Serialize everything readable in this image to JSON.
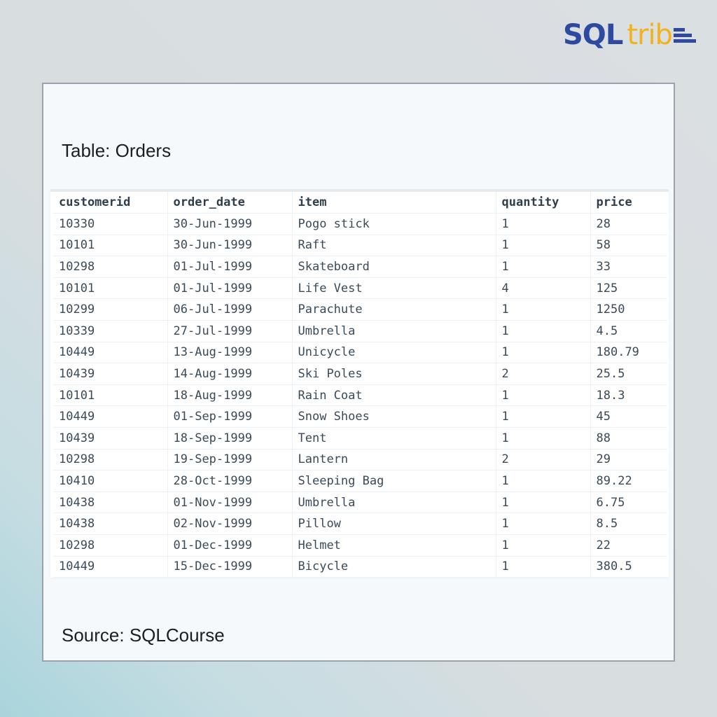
{
  "brand": {
    "part1": "SQL",
    "part2": "trib",
    "colors": {
      "sql": "#2d4aa0",
      "trib": "#f2b21b",
      "bars": "#2d4aa0"
    }
  },
  "card": {
    "title": "Table: Orders",
    "source": "Source: SQLCourse"
  },
  "table": {
    "columns": [
      "customerid",
      "order_date",
      "item",
      "quantity",
      "price"
    ],
    "rows": [
      [
        "10330",
        "30-Jun-1999",
        "Pogo stick",
        "1",
        "28"
      ],
      [
        "10101",
        "30-Jun-1999",
        "Raft",
        "1",
        "58"
      ],
      [
        "10298",
        "01-Jul-1999",
        "Skateboard",
        "1",
        "33"
      ],
      [
        "10101",
        "01-Jul-1999",
        "Life Vest",
        "4",
        "125"
      ],
      [
        "10299",
        "06-Jul-1999",
        "Parachute",
        "1",
        "1250"
      ],
      [
        "10339",
        "27-Jul-1999",
        "Umbrella",
        "1",
        "4.5"
      ],
      [
        "10449",
        "13-Aug-1999",
        "Unicycle",
        "1",
        "180.79"
      ],
      [
        "10439",
        "14-Aug-1999",
        "Ski Poles",
        "2",
        "25.5"
      ],
      [
        "10101",
        "18-Aug-1999",
        "Rain Coat",
        "1",
        "18.3"
      ],
      [
        "10449",
        "01-Sep-1999",
        "Snow Shoes",
        "1",
        "45"
      ],
      [
        "10439",
        "18-Sep-1999",
        "Tent",
        "1",
        "88"
      ],
      [
        "10298",
        "19-Sep-1999",
        "Lantern",
        "2",
        "29"
      ],
      [
        "10410",
        "28-Oct-1999",
        "Sleeping Bag",
        "1",
        "89.22"
      ],
      [
        "10438",
        "01-Nov-1999",
        "Umbrella",
        "1",
        "6.75"
      ],
      [
        "10438",
        "02-Nov-1999",
        "Pillow",
        "1",
        "8.5"
      ],
      [
        "10298",
        "01-Dec-1999",
        "Helmet",
        "1",
        "22"
      ],
      [
        "10449",
        "15-Dec-1999",
        "Bicycle",
        "1",
        "380.5"
      ]
    ]
  }
}
